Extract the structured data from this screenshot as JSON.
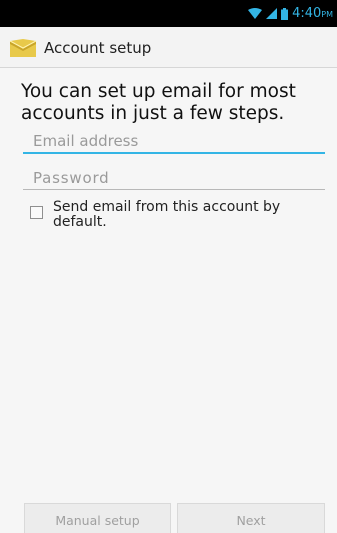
{
  "status_bar": {
    "time": "4:40",
    "ampm": "PM",
    "icons": [
      "wifi-icon",
      "signal-icon",
      "battery-icon"
    ],
    "accent_color": "#33b5e5"
  },
  "action_bar": {
    "app_icon": "email-envelope-icon",
    "title": "Account setup"
  },
  "main": {
    "instructions": "You can set up email for most accounts in just a few steps.",
    "email": {
      "placeholder": "Email address",
      "value": ""
    },
    "password": {
      "placeholder": "Password",
      "value": ""
    },
    "default_checkbox": {
      "label": "Send email from this account by default.",
      "checked": false
    }
  },
  "footer": {
    "manual_setup_label": "Manual setup",
    "next_label": "Next"
  }
}
